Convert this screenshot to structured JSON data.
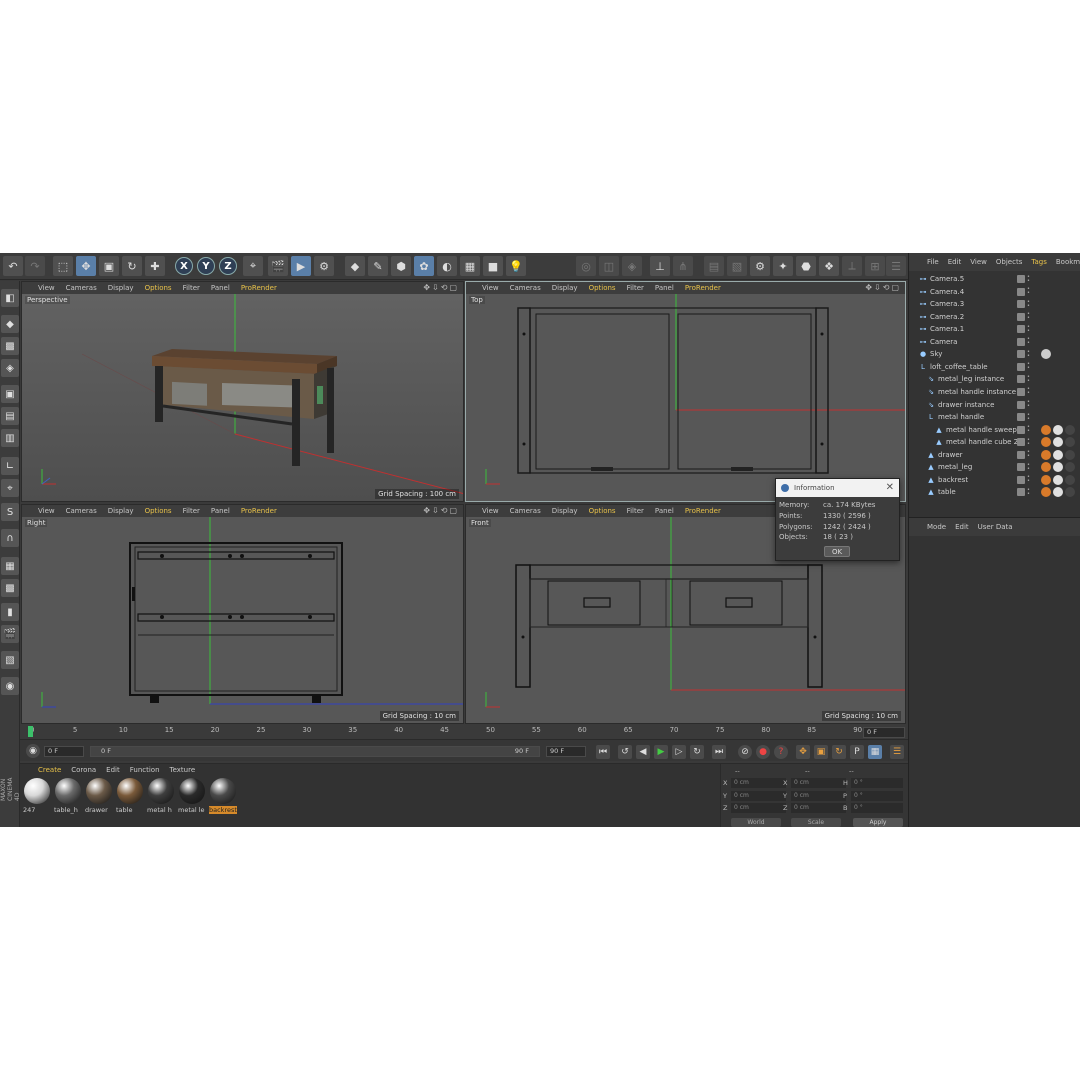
{
  "viewport_menu": {
    "view": "View",
    "cameras": "Cameras",
    "display": "Display",
    "options": "Options",
    "filter": "Filter",
    "panel": "Panel",
    "prorender": "ProRender"
  },
  "viewports": {
    "perspective": {
      "label": "Perspective",
      "grid": "Grid Spacing : 100 cm"
    },
    "top": {
      "label": "Top",
      "grid": ""
    },
    "right": {
      "label": "Right",
      "grid": "Grid Spacing : 10 cm"
    },
    "front": {
      "label": "Front",
      "grid": "Grid Spacing : 10 cm"
    }
  },
  "toolbar": {
    "x": "X",
    "y": "Y",
    "z": "Z"
  },
  "object_manager": {
    "menu": [
      "File",
      "Edit",
      "View",
      "Objects",
      "Tags",
      "Bookmarks"
    ],
    "active_menu": "Tags",
    "objects": [
      {
        "name": "Camera.5",
        "depth": 0,
        "icon": "camera-icon"
      },
      {
        "name": "Camera.4",
        "depth": 0,
        "icon": "camera-icon"
      },
      {
        "name": "Camera.3",
        "depth": 0,
        "icon": "camera-icon"
      },
      {
        "name": "Camera.2",
        "depth": 0,
        "icon": "camera-icon"
      },
      {
        "name": "Camera.1",
        "depth": 0,
        "icon": "camera-icon"
      },
      {
        "name": "Camera",
        "depth": 0,
        "icon": "camera-icon"
      },
      {
        "name": "Sky",
        "depth": 0,
        "icon": "sky-icon"
      },
      {
        "name": "loft_coffee_table",
        "depth": 0,
        "icon": "null-icon"
      },
      {
        "name": "metal_leg instance",
        "depth": 1,
        "icon": "instance-icon"
      },
      {
        "name": "metal handle instance",
        "depth": 1,
        "icon": "instance-icon"
      },
      {
        "name": "drawer instance",
        "depth": 1,
        "icon": "instance-icon"
      },
      {
        "name": "metal handle",
        "depth": 1,
        "icon": "null-icon"
      },
      {
        "name": "metal handle sweep",
        "depth": 2,
        "icon": "polygon-icon"
      },
      {
        "name": "metal handle cube 2",
        "depth": 2,
        "icon": "polygon-icon"
      },
      {
        "name": "drawer",
        "depth": 1,
        "icon": "polygon-icon"
      },
      {
        "name": "metal_leg",
        "depth": 1,
        "icon": "polygon-icon"
      },
      {
        "name": "backrest",
        "depth": 1,
        "icon": "polygon-icon"
      },
      {
        "name": "table",
        "depth": 1,
        "icon": "polygon-icon"
      }
    ]
  },
  "attribute_manager": {
    "menu": [
      "Mode",
      "Edit",
      "User Data"
    ]
  },
  "info_dialog": {
    "title": "Information",
    "rows": [
      {
        "label": "Memory:",
        "value": "ca. 174 KBytes"
      },
      {
        "label": "Points:",
        "value": "1330 ( 2596 )"
      },
      {
        "label": "Polygons:",
        "value": "1242 ( 2424 )"
      },
      {
        "label": "Objects:",
        "value": "18 ( 23 )"
      }
    ],
    "ok": "OK"
  },
  "timeline": {
    "ticks": [
      "0",
      "5",
      "10",
      "15",
      "20",
      "25",
      "30",
      "35",
      "40",
      "45",
      "50",
      "55",
      "60",
      "65",
      "70",
      "75",
      "80",
      "85",
      "90"
    ],
    "current_frame": "0 F",
    "start_frame": "0 F",
    "range_start": "0 F",
    "range_end": "90 F",
    "end_frame": "90 F"
  },
  "material_manager": {
    "menu": [
      "Create",
      "Corona",
      "Edit",
      "Function",
      "Texture"
    ],
    "active_menu": "Create",
    "materials": [
      {
        "label": "247",
        "color": "#d8d8d8"
      },
      {
        "label": "table_h",
        "color": "#6a6a6a"
      },
      {
        "label": "drawer",
        "color": "#6b5a48"
      },
      {
        "label": "table",
        "color": "#7a5a3a"
      },
      {
        "label": "metal h",
        "color": "#3e3e3e"
      },
      {
        "label": "metal le",
        "color": "#2a2a2a"
      },
      {
        "label": "backrest",
        "color": "#4a4a4a",
        "selected": true
      }
    ]
  },
  "coordinates": {
    "header": [
      "--",
      "--",
      "--"
    ],
    "rows": [
      {
        "a": "X",
        "av": "0 cm",
        "b": "X",
        "bv": "0 cm",
        "c": "H",
        "cv": "0 °"
      },
      {
        "a": "Y",
        "av": "0 cm",
        "b": "Y",
        "bv": "0 cm",
        "c": "P",
        "cv": "0 °"
      },
      {
        "a": "Z",
        "av": "0 cm",
        "b": "Z",
        "bv": "0 cm",
        "c": "B",
        "cv": "0 °"
      }
    ],
    "world": "World",
    "scale": "Scale",
    "apply": "Apply"
  },
  "brand": "MAXON CINEMA 4D",
  "colors": {
    "accent": "#e8c24a",
    "selection": "#5a7fa8",
    "material_selected": "#d68a2a"
  }
}
